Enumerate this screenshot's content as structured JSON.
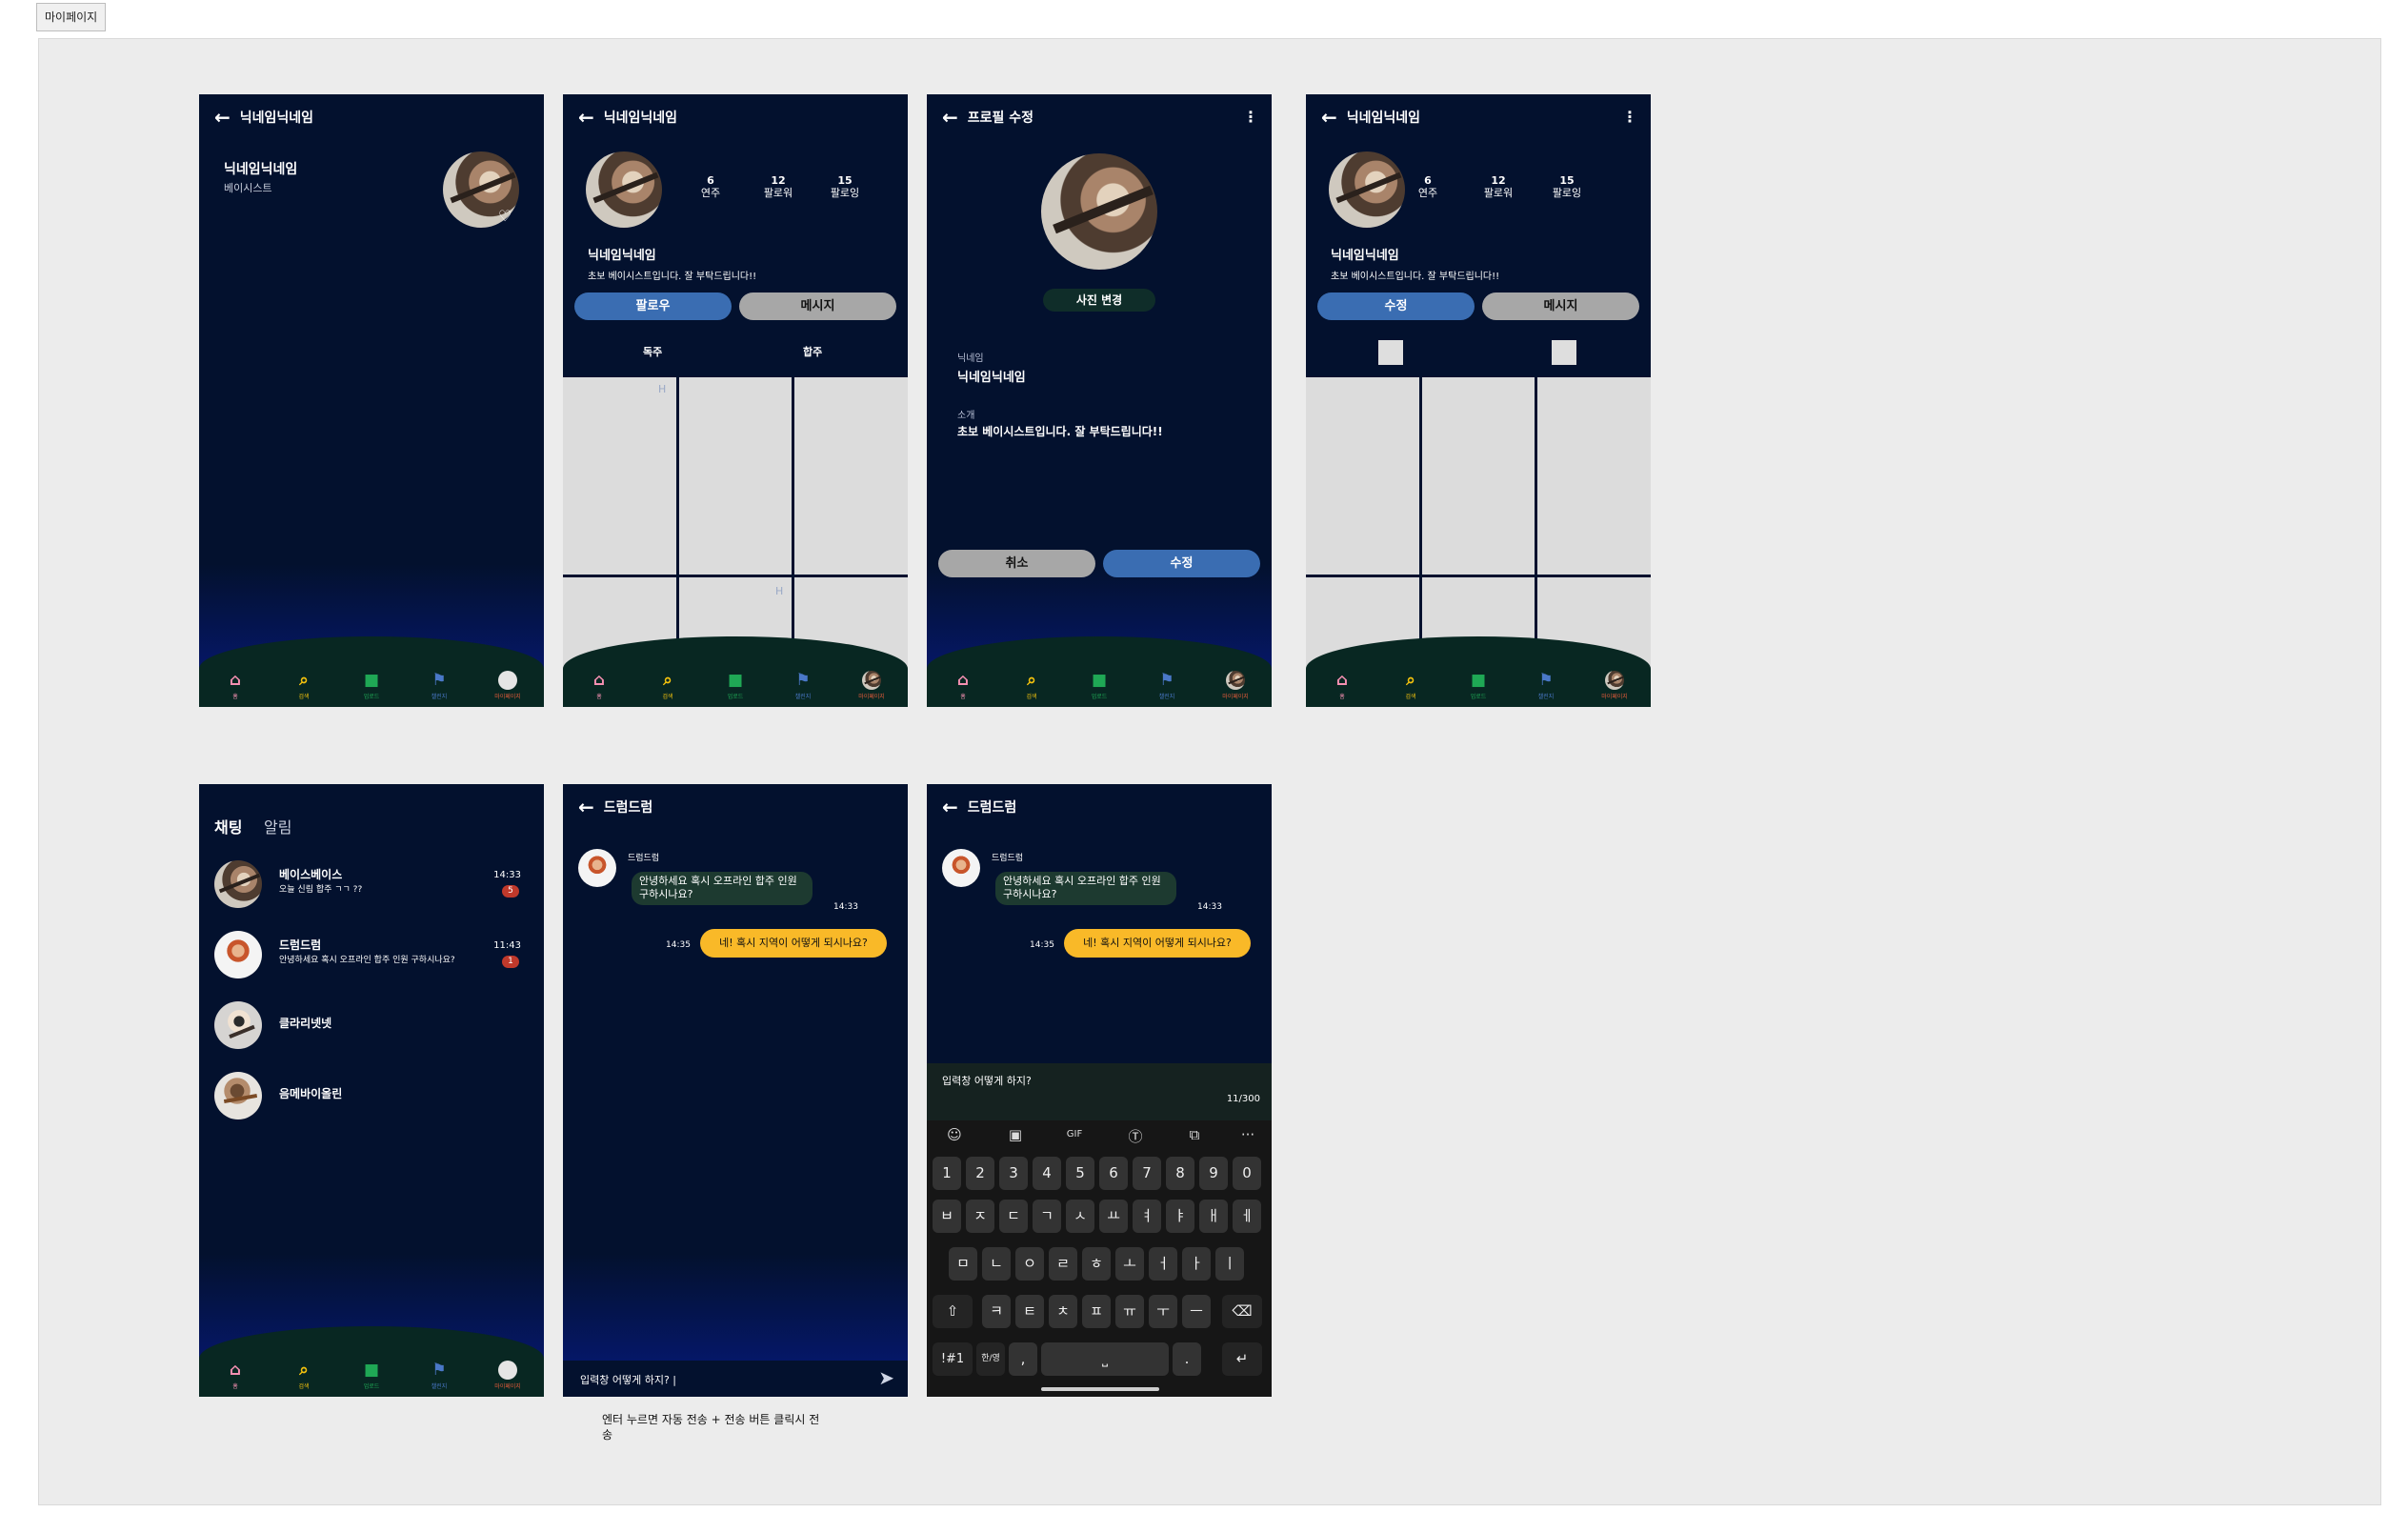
{
  "page_tag": "마이페이지",
  "nav": {
    "items": [
      {
        "icon": "⌂",
        "label": "홈",
        "color": "#f48fb1"
      },
      {
        "icon": "⌕",
        "label": "검색",
        "color": "#f4c20d"
      },
      {
        "icon": "■",
        "label": "업로드",
        "color": "#1fa855"
      },
      {
        "icon": "⚑",
        "label": "챌린지",
        "color": "#4a78c8"
      },
      {
        "icon": "●",
        "label": "마이페이지",
        "color": "#e05a3a"
      }
    ]
  },
  "screen1": {
    "title": "닉네임닉네임",
    "name": "닉네임닉네임",
    "role": "베이시스트",
    "heart": "♡"
  },
  "profile": {
    "title": "닉네임닉네임",
    "stats": [
      {
        "n": "6",
        "l": "연주"
      },
      {
        "n": "12",
        "l": "팔로워"
      },
      {
        "n": "15",
        "l": "팔로잉"
      }
    ],
    "name": "닉네임닉네임",
    "bio": "초보 베이시스트입니다. 잘 부탁드립니다!!",
    "follow": "팔로우",
    "message": "메시지",
    "edit": "수정",
    "tab_solo": "독주",
    "tab_ensemble": "합주",
    "placeholder_h": "H"
  },
  "edit_screen": {
    "title": "프로필 수정",
    "change_photo": "사진 변경",
    "nick_label": "닉네임",
    "nick_value": "닉네임닉네임",
    "bio_label": "소개",
    "bio_value": "초보 베이시스트입니다. 잘 부탁드립니다!!",
    "cancel": "취소",
    "save": "수정"
  },
  "chat_list": {
    "tab_chat": "채팅",
    "tab_alarm": "알림",
    "rows": [
      {
        "name": "베이스베이스",
        "preview": "오늘 신림 합주 ㄱㄱ ??",
        "time": "14:33",
        "badge": "5"
      },
      {
        "name": "드럼드럼",
        "preview": "안녕하세요 혹시 오프라인 합주 인원 구하시나요?",
        "time": "11:43",
        "badge": "1"
      },
      {
        "name": "클라리넷넷",
        "preview": "",
        "time": "",
        "badge": ""
      },
      {
        "name": "음메바이올린",
        "preview": "",
        "time": "",
        "badge": ""
      }
    ]
  },
  "chat_room": {
    "title": "드럼드럼",
    "sender": "드럼드럼",
    "incoming": "안녕하세요 혹시 오프라인 합주 인원 구하시나요?",
    "incoming_time": "14:33",
    "outgoing": "네! 혹시 지역이 어떻게 되시나요?",
    "outgoing_time": "14:35",
    "input_text": "입력창 어떻게 하지? |",
    "send_icon": "➤",
    "draft_text": "입력창 어떻게 하지?",
    "counter": "11/300"
  },
  "note": "엔터 누르면 자동 전송 + 전송 버튼 클릭시 전송",
  "keyboard": {
    "tools": [
      "☺",
      "▣",
      "GIF",
      "Ⓣ",
      "⧉",
      "···"
    ],
    "row1": [
      "1",
      "2",
      "3",
      "4",
      "5",
      "6",
      "7",
      "8",
      "9",
      "0"
    ],
    "row2": [
      "ㅂ",
      "ㅈ",
      "ㄷ",
      "ㄱ",
      "ㅅ",
      "ㅛ",
      "ㅕ",
      "ㅑ",
      "ㅐ",
      "ㅔ"
    ],
    "row3": [
      "ㅁ",
      "ㄴ",
      "ㅇ",
      "ㄹ",
      "ㅎ",
      "ㅗ",
      "ㅓ",
      "ㅏ",
      "ㅣ"
    ],
    "row4": [
      "⇧",
      "ㅋ",
      "ㅌ",
      "ㅊ",
      "ㅍ",
      "ㅠ",
      "ㅜ",
      "ㅡ",
      "⌫"
    ],
    "row5": [
      "!#1",
      "한/영",
      ",",
      "⎵",
      ".",
      "↵"
    ]
  }
}
